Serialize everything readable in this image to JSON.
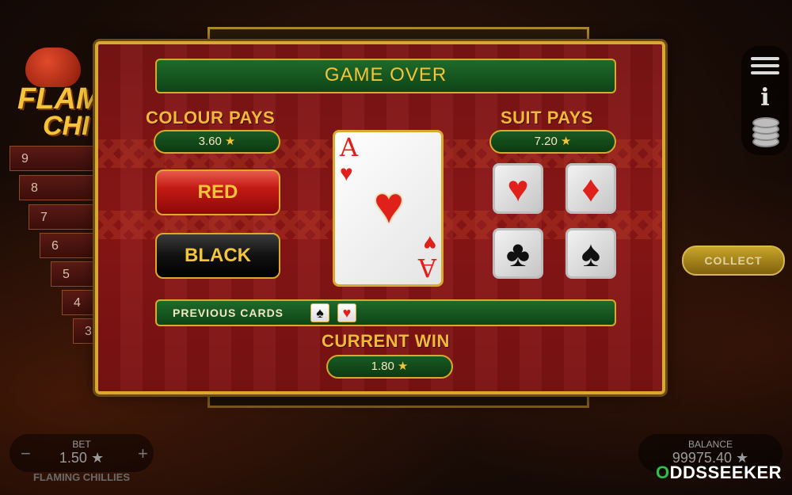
{
  "background": {
    "logo": {
      "line1": "FLAM",
      "line2": "CHI"
    },
    "ladder": [
      "9",
      "8",
      "7",
      "6",
      "5",
      "4",
      "3"
    ],
    "collect_label": "COLLECT",
    "bet": {
      "label": "BET",
      "value": "1.50 ★",
      "minus": "−",
      "plus": "+"
    },
    "game_name": "FLAMING CHILLIES",
    "balance": {
      "label": "BALANCE",
      "value": "99975.40 ★"
    },
    "watermark": {
      "first": "O",
      "rest": "DDSSEEKER"
    }
  },
  "dialog": {
    "title": "GAME OVER",
    "colour_pays": {
      "title": "COLOUR PAYS",
      "value": "3.60",
      "star": "★"
    },
    "suit_pays": {
      "title": "SUIT PAYS",
      "value": "7.20",
      "star": "★"
    },
    "buttons": {
      "red": "RED",
      "black": "BLACK"
    },
    "card": {
      "rank": "A",
      "suit": "♥"
    },
    "suits": {
      "hearts": "♥",
      "diamonds": "♦",
      "clubs": "♣",
      "spades": "♠"
    },
    "previous_cards": {
      "label": "PREVIOUS CARDS",
      "cards": [
        "♠",
        "♥"
      ]
    },
    "current_win": {
      "title": "CURRENT WIN",
      "value": "1.80",
      "star": "★"
    }
  },
  "colors": {
    "gold": "#d9a830",
    "green": "#1f6a2a",
    "red_felt": "#8e1616"
  }
}
